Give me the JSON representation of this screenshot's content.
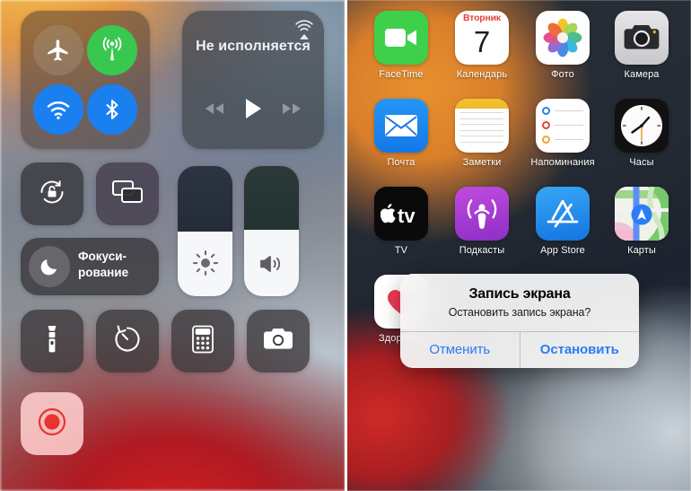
{
  "control_center": {
    "connectivity": {
      "airplane": {
        "name": "Авиарежим",
        "state": "off",
        "color": "#a09682"
      },
      "cellular": {
        "name": "Сотовые данные",
        "state": "on",
        "color": "#38c850"
      },
      "wifi": {
        "name": "Wi-Fi",
        "state": "on",
        "color": "#1a80f0"
      },
      "bluetooth": {
        "name": "Bluetooth",
        "state": "on",
        "color": "#1a80f0"
      }
    },
    "now_playing": {
      "title": "Не исполняется",
      "airplay_icon": "airplay-audio-icon",
      "rewind_icon": "rewind-icon",
      "play_icon": "play-icon",
      "forward_icon": "fast-forward-icon"
    },
    "rotation_lock": {
      "icon": "rotation-lock-icon",
      "state": "off"
    },
    "screen_mirroring": {
      "icon": "screen-mirroring-icon"
    },
    "focus": {
      "label": "Фокуси-\nрование",
      "label_line1": "Фокуси-",
      "label_line2": "рование",
      "icon": "moon-icon"
    },
    "brightness": {
      "icon": "brightness-icon",
      "value": 50
    },
    "volume": {
      "icon": "volume-icon",
      "value": 51
    },
    "utilities": [
      {
        "name": "Фонарик",
        "icon": "flashlight-icon"
      },
      {
        "name": "Таймер",
        "icon": "timer-icon"
      },
      {
        "name": "Калькулятор",
        "icon": "calculator-icon"
      },
      {
        "name": "Камера",
        "icon": "camera-icon"
      }
    ],
    "screen_record": {
      "name": "Запись экрана",
      "icon": "record-icon",
      "active": true,
      "color": "#e8332f"
    }
  },
  "home_screen": {
    "apps": [
      {
        "label": "FaceTime",
        "icon": "facetime-icon"
      },
      {
        "label": "Календарь",
        "icon": "calendar-icon",
        "weekday": "Вторник",
        "day": "7"
      },
      {
        "label": "Фото",
        "icon": "photos-icon"
      },
      {
        "label": "Камера",
        "icon": "camera-app-icon"
      },
      {
        "label": "Почта",
        "icon": "mail-icon"
      },
      {
        "label": "Заметки",
        "icon": "notes-icon"
      },
      {
        "label": "Напоминания",
        "icon": "reminders-icon"
      },
      {
        "label": "Часы",
        "icon": "clock-icon"
      },
      {
        "label": "TV",
        "icon": "appletv-icon"
      },
      {
        "label": "Подкасты",
        "icon": "podcasts-icon"
      },
      {
        "label": "App Store",
        "icon": "appstore-icon"
      },
      {
        "label": "Карты",
        "icon": "maps-icon"
      },
      {
        "label": "Здоровье",
        "icon": "health-icon"
      }
    ]
  },
  "alert": {
    "title": "Запись экрана",
    "message": "Остановить запись экрана?",
    "cancel": "Отменить",
    "confirm": "Остановить",
    "accent_color": "#2a7cf7"
  }
}
